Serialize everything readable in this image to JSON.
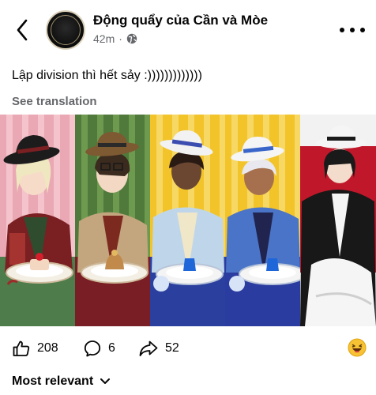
{
  "header": {
    "title": "Động quẩy của Cần và Mòe",
    "time": "42m",
    "dot": "·",
    "avatar_text": "Động quẩy của Cần và Mòe"
  },
  "post": {
    "text": "Lập division thì hết sảy :)))))))))))))",
    "see_translation": "See translation"
  },
  "stats": {
    "likes": "208",
    "comments": "6",
    "shares": "52"
  },
  "comments": {
    "sort_label": "Most relevant"
  },
  "icons": {
    "back": "chevron-left-icon",
    "globe": "globe-icon",
    "more": "more-horizontal-icon",
    "like": "thumbs-up-icon",
    "comment": "comment-bubble-icon",
    "share": "share-arrow-icon",
    "react": "laughing-emoji-icon",
    "sort": "chevron-down-icon"
  },
  "colors": {
    "text": "#050505",
    "secondary": "#65676b",
    "panel_pink": "#e9a8b4",
    "panel_green": "#4f7a3c",
    "panel_yellow": "#f2c42a",
    "panel_blue": "#2b3ca0",
    "panel_red": "#c0182a"
  }
}
